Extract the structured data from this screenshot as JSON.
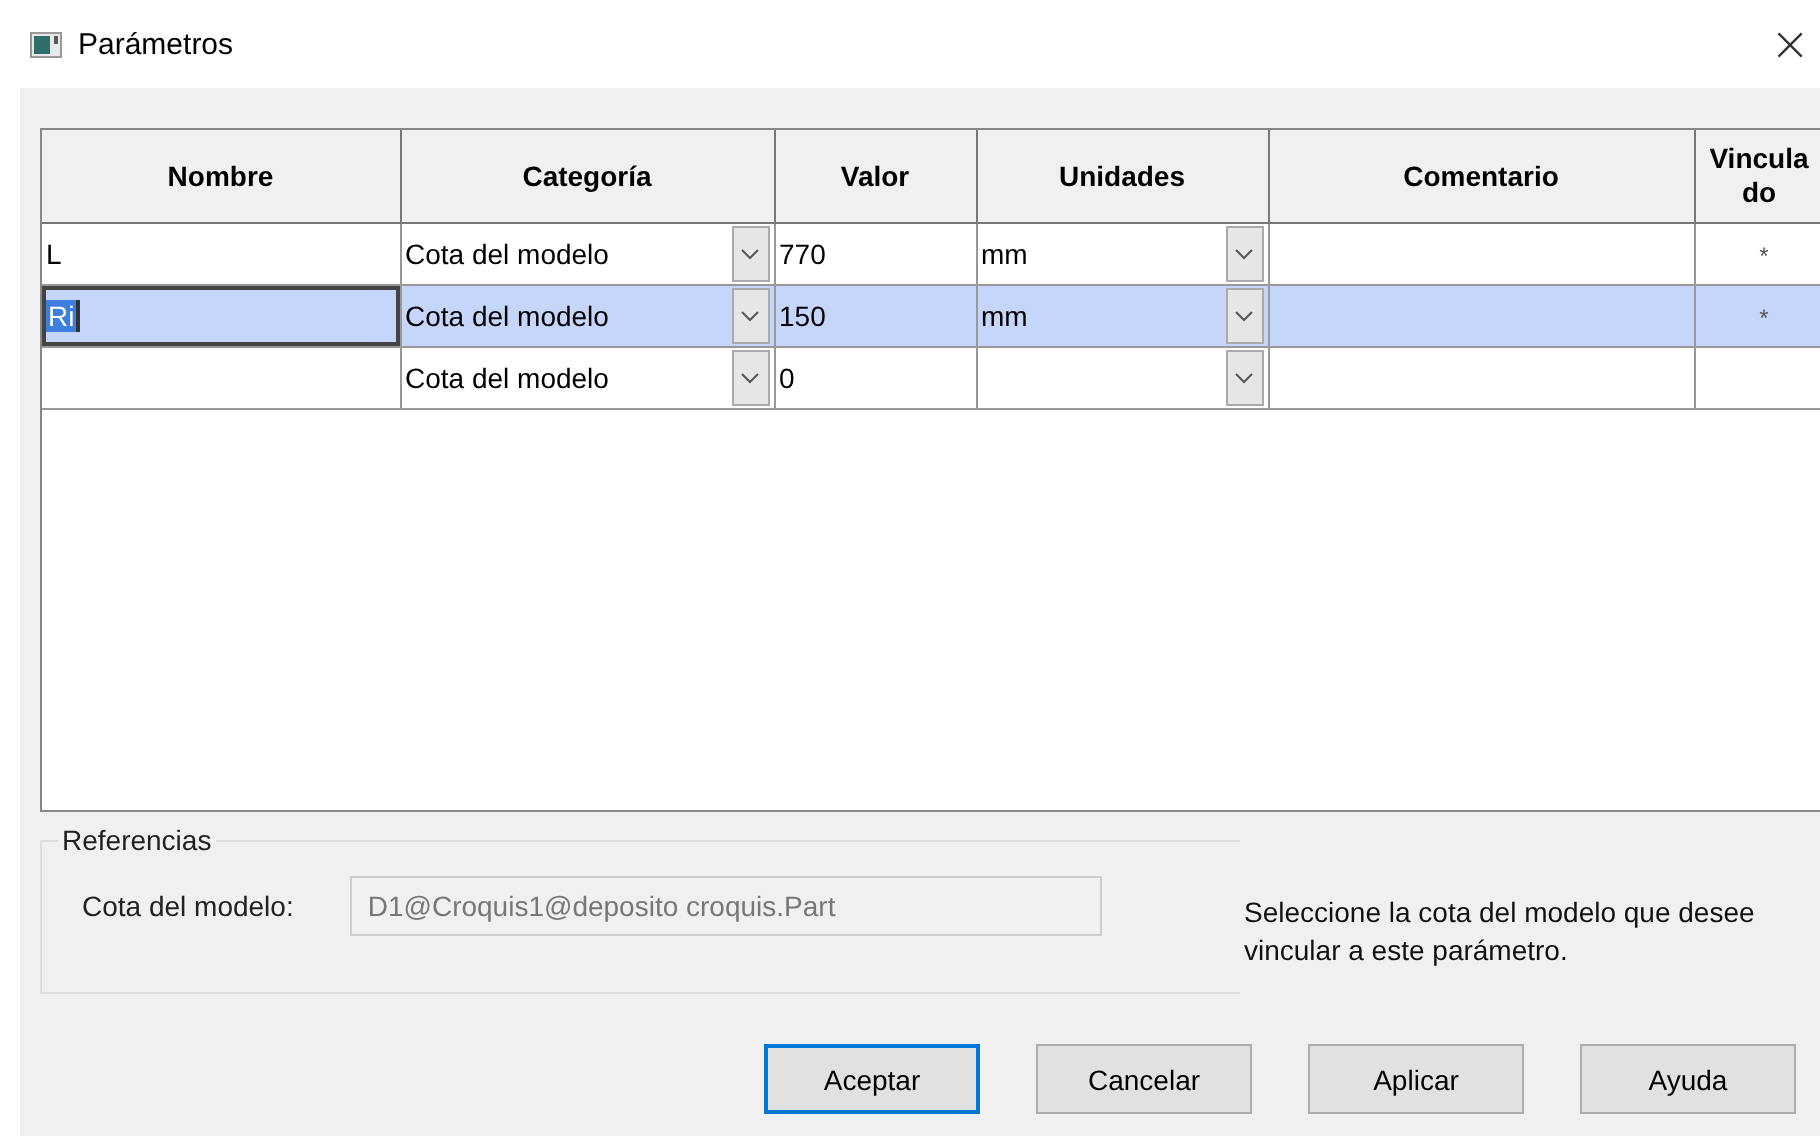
{
  "window": {
    "title": "Parámetros",
    "close": "×"
  },
  "table": {
    "columns": [
      "Nombre",
      "Categoría",
      "Valor",
      "Unidades",
      "Comentario",
      "Vinculado"
    ],
    "rows": [
      {
        "name": "L",
        "category": "Cota del modelo",
        "value": "770",
        "units": "mm",
        "linked": "*",
        "selected": false,
        "editing": false
      },
      {
        "name": "Ri",
        "category": "Cota del modelo",
        "value": "150",
        "units": "mm",
        "linked": "*",
        "selected": true,
        "editing": true
      },
      {
        "category": "Cota del modelo",
        "value": "0",
        "selected": false,
        "editing": false
      }
    ]
  },
  "references": {
    "title": "Referencias",
    "label": "Cota del modelo:",
    "value": "D1@Croquis1@deposito croquis.Part",
    "hint": "Seleccione la cota del modelo que desee vincular a este parámetro."
  },
  "buttons": [
    {
      "label": "Aceptar",
      "default": true
    },
    {
      "label": "Cancelar",
      "default": false
    },
    {
      "label": "Aplicar",
      "default": false
    },
    {
      "label": "Ayuda",
      "default": false
    }
  ]
}
